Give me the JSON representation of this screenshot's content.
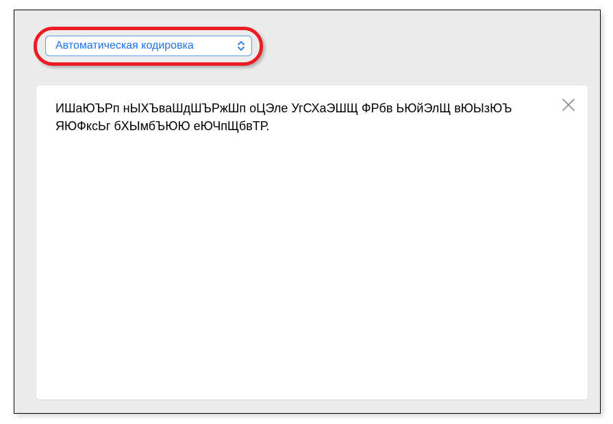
{
  "encoding_select": {
    "selected_label": "Автоматическая кодировка"
  },
  "content": {
    "text": "ИШаЮЪРп нЫХЪваШдШЪРжШп оЦЭле УгСХаЭШЩ ФРбв ЬЮйЭлЩ вЮЫзЮЪ ЯЮФксЬг бХЫмбЪЮЮ еЮЧпЩбвТР."
  }
}
